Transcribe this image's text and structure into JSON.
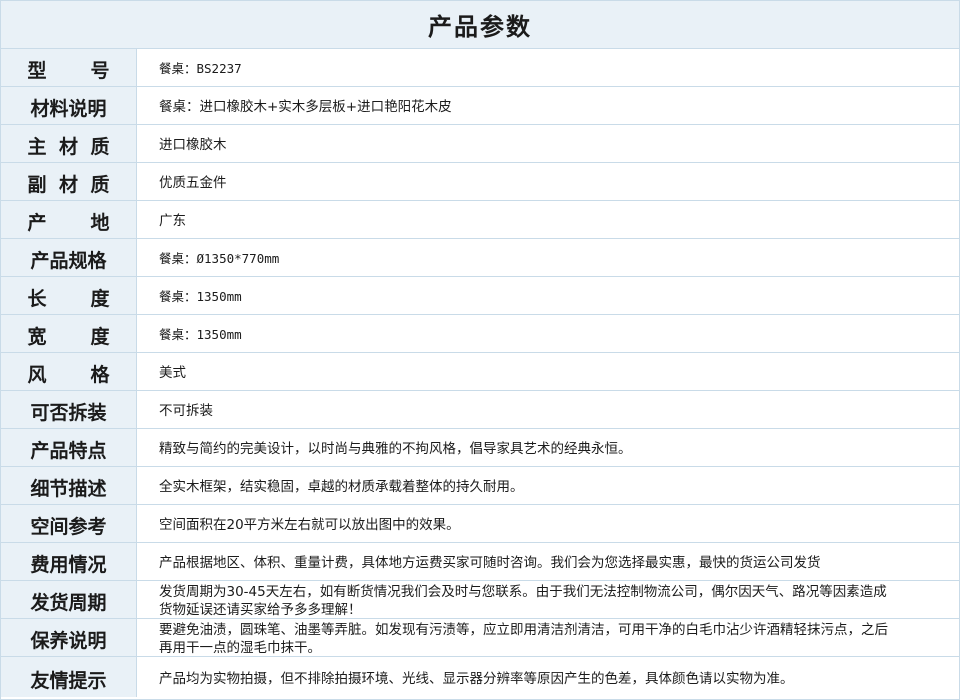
{
  "header": {
    "title": "产品参数"
  },
  "rows": [
    {
      "label": "型号",
      "spread": true,
      "value": "餐桌：BS2237",
      "mono": true
    },
    {
      "label": "材料说明",
      "spread": false,
      "value": "餐桌：进口橡胶木+实木多层板+进口艳阳花木皮",
      "mono": false
    },
    {
      "label": "主材质",
      "spread": true,
      "value": "进口橡胶木",
      "mono": false
    },
    {
      "label": "副材质",
      "spread": true,
      "value": "优质五金件",
      "mono": false
    },
    {
      "label": "产地",
      "spread": true,
      "value": "广东",
      "mono": false
    },
    {
      "label": "产品规格",
      "spread": false,
      "value": "餐桌：Ø1350*770mm",
      "mono": true
    },
    {
      "label": "长度",
      "spread": true,
      "value": "餐桌：1350mm",
      "mono": true
    },
    {
      "label": "宽度",
      "spread": true,
      "value": "餐桌：1350mm",
      "mono": true
    },
    {
      "label": "风格",
      "spread": true,
      "value": "美式",
      "mono": false
    },
    {
      "label": "可否拆装",
      "spread": false,
      "value": "不可拆装",
      "mono": false
    },
    {
      "label": "产品特点",
      "spread": false,
      "value": "精致与简约的完美设计，以时尚与典雅的不拘风格，倡导家具艺术的经典永恒。",
      "mono": false
    },
    {
      "label": "细节描述",
      "spread": false,
      "value": "全实木框架，结实稳固，卓越的材质承载着整体的持久耐用。",
      "mono": false
    },
    {
      "label": "空间参考",
      "spread": false,
      "value": "空间面积在20平方米左右就可以放出图中的效果。",
      "mono": false
    },
    {
      "label": "费用情况",
      "spread": false,
      "value": "产品根据地区、体积、重量计费，具体地方运费买家可随时咨询。我们会为您选择最实惠，最快的货运公司发货",
      "mono": false
    },
    {
      "label": "发货周期",
      "spread": false,
      "value": "发货周期为30-45天左右，如有断货情况我们会及时与您联系。由于我们无法控制物流公司，偶尔因天气、路况等因素造成货物延误还请买家给予多多理解！",
      "mono": false,
      "two_line": true
    },
    {
      "label": "保养说明",
      "spread": false,
      "value": "要避免油渍，圆珠笔、油墨等弄脏。如发现有污渍等，应立即用清洁剂清洁，可用干净的白毛巾沾少许酒精轻抹污点，之后再用干一点的湿毛巾抹干。",
      "mono": false,
      "two_line": true
    },
    {
      "label": "友情提示",
      "spread": false,
      "value": "产品均为实物拍摄，但不排除拍摄环境、光线、显示器分辨率等原因产生的色差，具体颜色请以实物为准。",
      "mono": false
    }
  ]
}
